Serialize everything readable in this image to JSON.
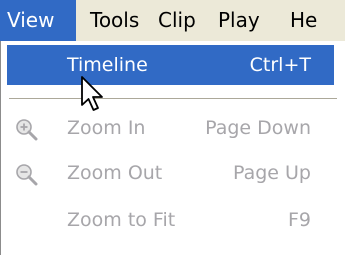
{
  "menubar": {
    "items": [
      {
        "label": "View",
        "active": true
      },
      {
        "label": "Tools"
      },
      {
        "label": "Clip"
      },
      {
        "label": "Play"
      },
      {
        "label": "He"
      }
    ]
  },
  "view_menu": {
    "items": [
      {
        "label": "Timeline",
        "shortcut": "Ctrl+T",
        "state": "highlighted"
      },
      {
        "label": "Zoom In",
        "shortcut": "Page Down",
        "icon": "zoom-in-icon",
        "state": "disabled"
      },
      {
        "label": "Zoom Out",
        "shortcut": "Page Up",
        "icon": "zoom-out-icon",
        "state": "disabled"
      },
      {
        "label": "Zoom to Fit",
        "shortcut": "F9",
        "state": "disabled"
      }
    ]
  },
  "colors": {
    "menubar_bg": "#ece9d8",
    "highlight": "#316ac5",
    "disabled_text": "#a7a6aa",
    "separator": "#aca899"
  }
}
